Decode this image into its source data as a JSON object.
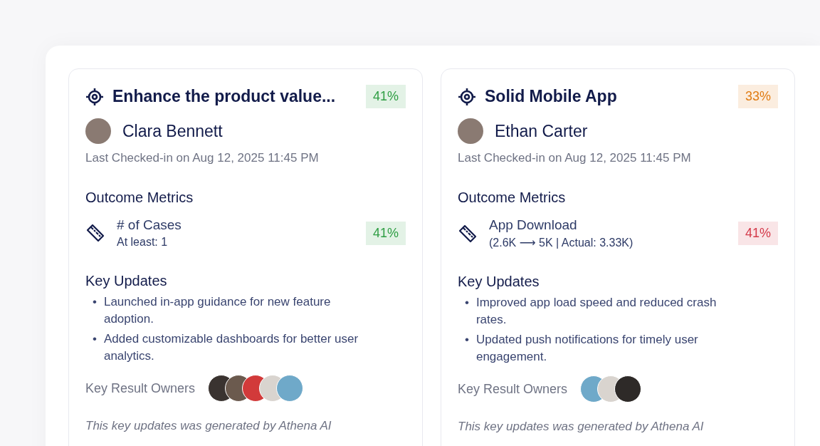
{
  "cards": [
    {
      "title": "Enhance the product value...",
      "progress": {
        "text": "41%",
        "color": "#2f9e44"
      },
      "owner": {
        "name": "Clara Bennett"
      },
      "checked_in": "Last Checked-in on Aug 12, 2025 11:45 PM",
      "metrics_heading": "Outcome Metrics",
      "metrics": [
        {
          "name": "# of Cases",
          "target": "At least: 1",
          "progress": {
            "text": "41%",
            "color": "#2f9e44"
          }
        }
      ],
      "updates_heading": "Key Updates",
      "updates": [
        {
          "bullet": "•",
          "text": "Launched in-app guidance for new feature adoption."
        },
        {
          "bullet": "•",
          "text": "Added customizable dashboards for better user analytics."
        }
      ],
      "owners_label": "Key Result Owners",
      "owner_avatars": [
        {
          "color": "#3a3330"
        },
        {
          "color": "#6b5a4e"
        },
        {
          "color": "#d23a3a"
        },
        {
          "color": "#d9d4cf"
        },
        {
          "color": "#6fa9c9"
        }
      ],
      "footnote": "This key updates was generated by Athena AI"
    },
    {
      "title": "Solid Mobile App",
      "progress": {
        "text": "33%",
        "color": "#e07b12"
      },
      "owner": {
        "name": "Ethan Carter"
      },
      "checked_in": "Last Checked-in on Aug 12, 2025 11:45 PM",
      "metrics_heading": "Outcome Metrics",
      "metrics": [
        {
          "name": "App Download",
          "target": "(2.6K ⟶ 5K | Actual: 3.33K)",
          "progress": {
            "text": "41%",
            "color": "#d43a4a"
          }
        }
      ],
      "updates_heading": "Key Updates",
      "updates": [
        {
          "bullet": "•",
          "text": "Improved app load speed and reduced crash rates."
        },
        {
          "bullet": "•",
          "text": "Updated push notifications for timely user engagement."
        }
      ],
      "owners_label": "Key Result Owners",
      "owner_avatars": [
        {
          "color": "#6fa9c9"
        },
        {
          "color": "#d9d4cf"
        },
        {
          "color": "#2e2a28"
        }
      ],
      "footnote": "This key updates was generated by Athena AI"
    }
  ]
}
